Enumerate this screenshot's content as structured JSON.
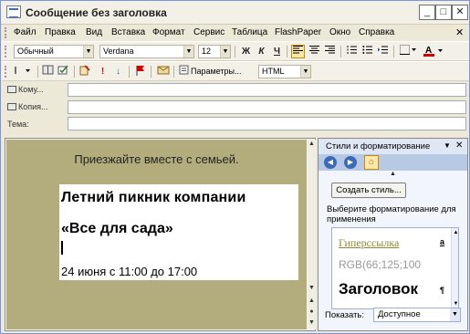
{
  "window": {
    "title": "Сообщение без заголовка",
    "buttons": {
      "minimize": "_",
      "maximize": "□",
      "close": "✕"
    }
  },
  "menu": {
    "items": [
      "Файл",
      "Правка",
      "Вид",
      "Вставка",
      "Формат",
      "Сервис",
      "Таблица",
      "FlashPaper",
      "Окно",
      "Справка"
    ],
    "close_doc": "✕"
  },
  "format_toolbar": {
    "style": "Обычный",
    "font": "Verdana",
    "size": "12",
    "bold": "Ж",
    "italic": "К",
    "underline": "Ч"
  },
  "standard_toolbar": {
    "options_label": "Параметры...",
    "format_value": "HTML"
  },
  "fields": {
    "to_label": "Кому...",
    "to_value": "",
    "cc_label": "Копия...",
    "cc_value": "",
    "subject_label": "Тема:",
    "subject_value": ""
  },
  "document": {
    "intro": "Приезжайте вместе с семьей.",
    "heading1": "Летний пикник компании",
    "heading2": "«Все для сада»",
    "datetime": "24 июня с 11:00 до 17:00",
    "background": "#b3ad7e"
  },
  "task_pane": {
    "title": "Стили и форматирование",
    "new_style_button": "Создать стиль...",
    "choose_label": "Выберите форматирование для применения",
    "styles": [
      {
        "name": "Гиперссылка",
        "mark": "a"
      },
      {
        "name": "RGB(66;125;100",
        "mark": ""
      },
      {
        "name": "Заголовок",
        "mark": "¶"
      }
    ],
    "show_label": "Показать:",
    "show_value": "Доступное"
  }
}
